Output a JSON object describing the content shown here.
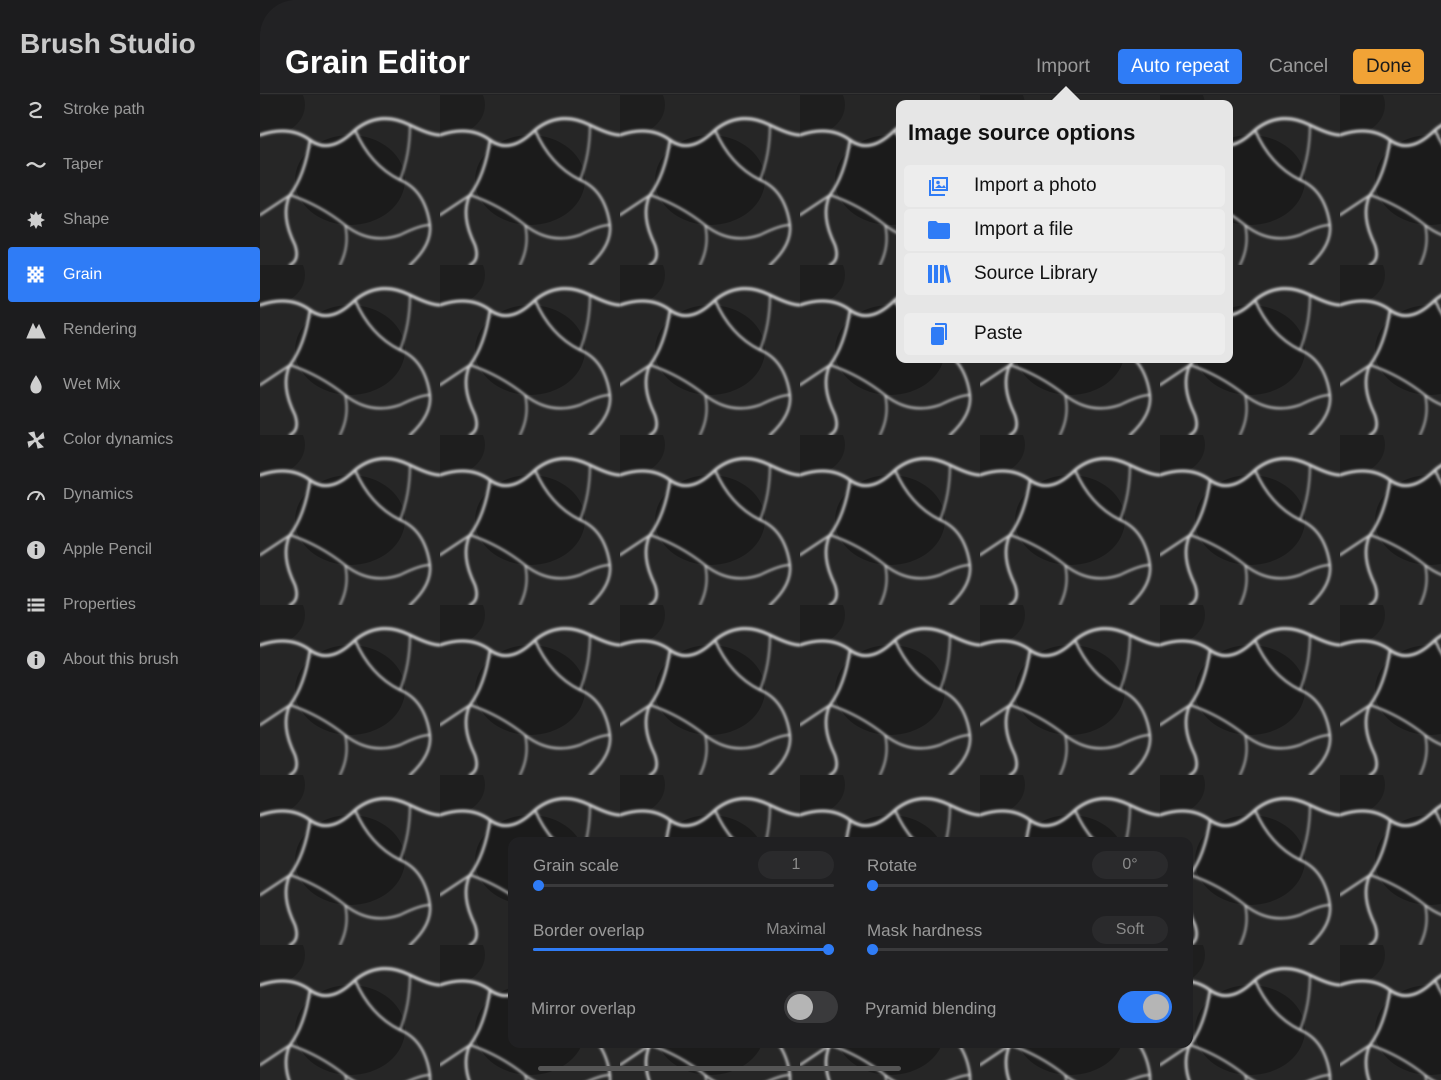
{
  "sidebar": {
    "title": "Brush Studio",
    "items": [
      {
        "label": "Stroke path",
        "icon": "stroke-path-icon"
      },
      {
        "label": "Taper",
        "icon": "taper-icon"
      },
      {
        "label": "Shape",
        "icon": "shape-icon"
      },
      {
        "label": "Grain",
        "icon": "grain-icon",
        "active": true
      },
      {
        "label": "Rendering",
        "icon": "rendering-icon"
      },
      {
        "label": "Wet Mix",
        "icon": "wet-mix-icon"
      },
      {
        "label": "Color dynamics",
        "icon": "color-dynamics-icon"
      },
      {
        "label": "Dynamics",
        "icon": "dynamics-icon"
      },
      {
        "label": "Apple Pencil",
        "icon": "apple-pencil-icon"
      },
      {
        "label": "Properties",
        "icon": "properties-icon"
      },
      {
        "label": "About this brush",
        "icon": "info-icon"
      }
    ]
  },
  "header": {
    "title": "Grain Editor",
    "import_label": "Import",
    "auto_repeat_label": "Auto repeat",
    "cancel_label": "Cancel",
    "done_label": "Done"
  },
  "popover": {
    "title": "Image source options",
    "items": [
      {
        "label": "Import a photo",
        "icon": "photo-icon"
      },
      {
        "label": "Import a file",
        "icon": "folder-icon"
      },
      {
        "label": "Source Library",
        "icon": "library-icon"
      },
      {
        "label": "Paste",
        "icon": "paste-icon"
      }
    ]
  },
  "controls": {
    "grain_scale": {
      "label": "Grain scale",
      "value": "1",
      "level": 0.0
    },
    "rotate": {
      "label": "Rotate",
      "value": "0°",
      "level": 0.0
    },
    "border_overlap": {
      "label": "Border overlap",
      "value": "Maximal",
      "level": 1.0
    },
    "mask_hardness": {
      "label": "Mask hardness",
      "value": "Soft",
      "level": 0.0
    },
    "mirror_overlap": {
      "label": "Mirror overlap",
      "on": false
    },
    "pyramid_blending": {
      "label": "Pyramid blending",
      "on": true
    }
  },
  "colors": {
    "accent": "#2f7cf6",
    "done": "#f1a336",
    "background": "#1c1c1e"
  }
}
